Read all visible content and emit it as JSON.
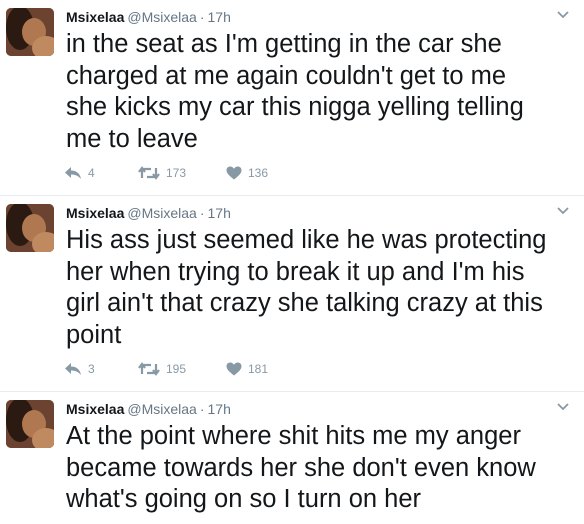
{
  "tweets": [
    {
      "name": "Msixelaa",
      "handle": "@Msixelaa",
      "time": "17h",
      "lines": [
        "in the seat as I'm getting in the car she",
        "charged at me again couldn't get to me",
        "she kicks my car this nigga yelling telling",
        "me to leave"
      ],
      "replies": "4",
      "retweets": "173",
      "likes": "136"
    },
    {
      "name": "Msixelaa",
      "handle": "@Msixelaa",
      "time": "17h",
      "lines": [
        "His ass just seemed like he was protecting",
        "her when trying to break it up and I'm his",
        "girl ain't that crazy she talking crazy at this",
        "point"
      ],
      "replies": "3",
      "retweets": "195",
      "likes": "181"
    },
    {
      "name": "Msixelaa",
      "handle": "@Msixelaa",
      "time": "17h",
      "lines": [
        "At the point where shit hits me my anger",
        "became towards her she don't even know",
        "what's going on so I turn on her"
      ]
    }
  ],
  "colors": {
    "text": "#14171a",
    "meta": "#657786",
    "action": "#8899a6",
    "divider": "#e6ecf0"
  },
  "icons": [
    "reply-icon",
    "retweet-icon",
    "heart-icon",
    "chevron-down-icon"
  ]
}
